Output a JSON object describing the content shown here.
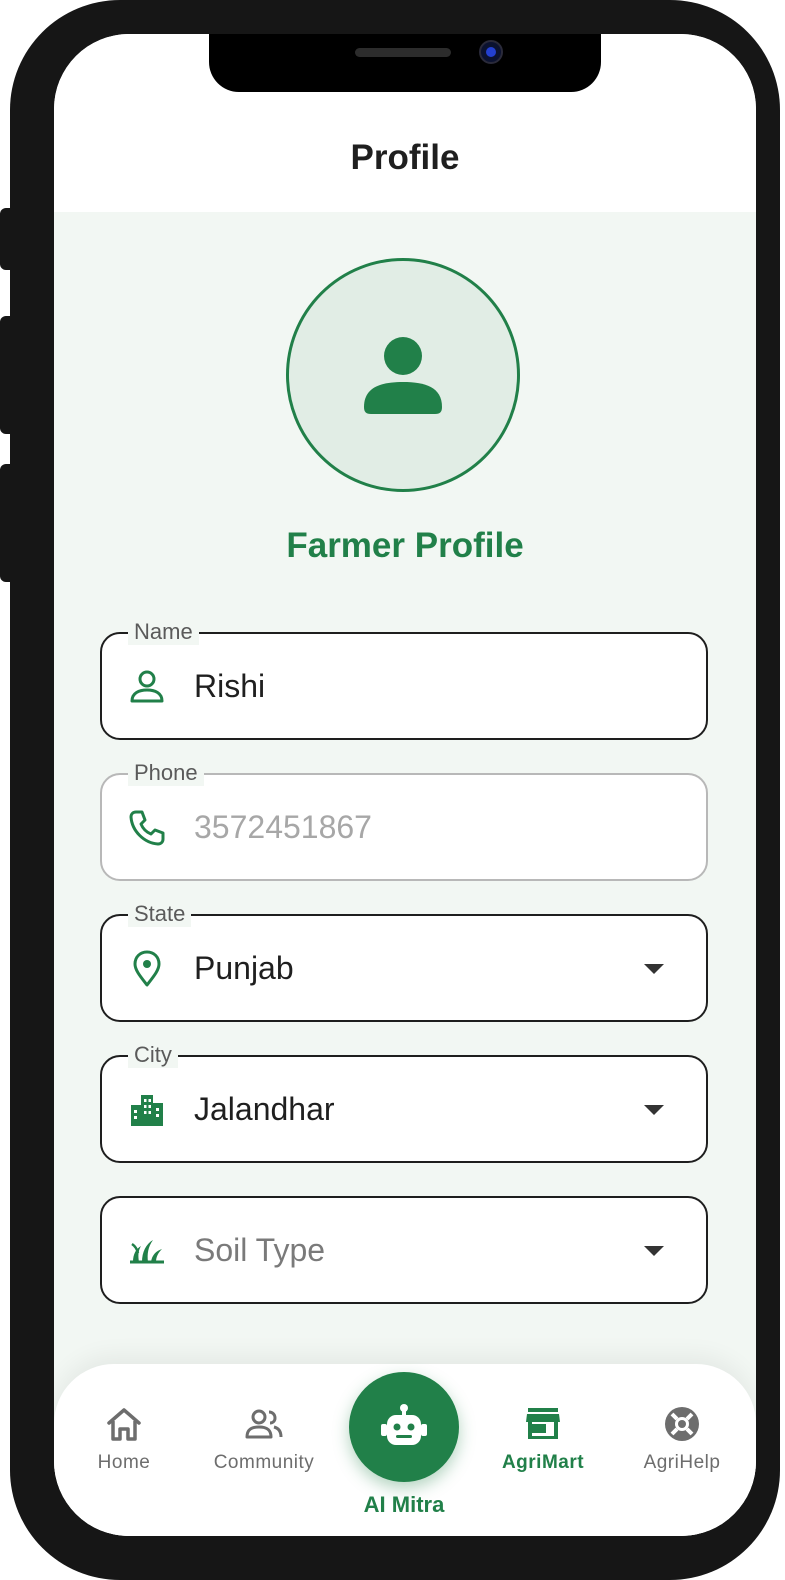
{
  "appbar": {
    "title": "Profile"
  },
  "profile": {
    "heading": "Farmer Profile",
    "avatar_icon": "person-icon"
  },
  "form": {
    "name": {
      "label": "Name",
      "value": "Rishi",
      "icon": "person-outline-icon"
    },
    "phone": {
      "label": "Phone",
      "value": "3572451867",
      "icon": "phone-icon",
      "disabled": true
    },
    "state": {
      "label": "State",
      "value": "Punjab",
      "icon": "location-pin-icon"
    },
    "city": {
      "label": "City",
      "value": "Jalandhar",
      "icon": "city-building-icon"
    },
    "soil": {
      "placeholder": "Soil Type",
      "icon": "grass-icon"
    }
  },
  "nav": {
    "items": [
      {
        "label": "Home",
        "icon": "home-icon"
      },
      {
        "label": "Community",
        "icon": "community-icon"
      },
      {
        "label": "AI Mitra",
        "icon": "robot-icon"
      },
      {
        "label": "AgriMart",
        "icon": "store-icon",
        "active": true
      },
      {
        "label": "AgriHelp",
        "icon": "help-lifebuoy-icon"
      }
    ]
  },
  "colors": {
    "accent": "#218049",
    "background": "#f2f7f3",
    "avatar_fill": "#e1ede5"
  }
}
